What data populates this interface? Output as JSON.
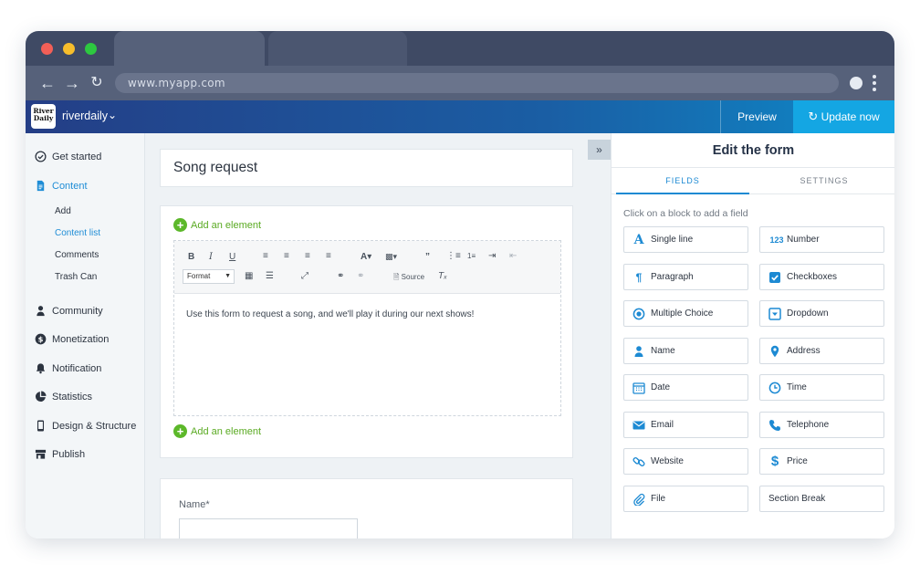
{
  "browser": {
    "url": "www.myapp.com",
    "colors": {
      "close": "#f25f57",
      "minimize": "#f7be2c",
      "maximize": "#2dc840"
    }
  },
  "header": {
    "logo_text": "River Daily",
    "site_name": "riverdaily",
    "preview_label": "Preview",
    "update_label": "Update now"
  },
  "sidebar": {
    "items": [
      {
        "label": "Get started",
        "icon": "check-circle-icon"
      },
      {
        "label": "Content",
        "icon": "document-icon",
        "active": true
      },
      {
        "label": "Community",
        "icon": "user-icon"
      },
      {
        "label": "Monetization",
        "icon": "dollar-icon"
      },
      {
        "label": "Notification",
        "icon": "bell-icon"
      },
      {
        "label": "Statistics",
        "icon": "pie-chart-icon"
      },
      {
        "label": "Design & Structure",
        "icon": "mobile-icon"
      },
      {
        "label": "Publish",
        "icon": "store-icon"
      }
    ],
    "content_sub": [
      "Add",
      "Content list",
      "Comments",
      "Trash Can"
    ]
  },
  "main": {
    "form_title": "Song request",
    "add_element_label": "Add an element",
    "editor": {
      "format_label": "Format",
      "source_label": "Source",
      "body_text": "Use this form to request a song, and we'll play it during our next shows!"
    },
    "name_field_label": "Name*"
  },
  "panel": {
    "title": "Edit the form",
    "tabs": [
      "FIELDS",
      "SETTINGS"
    ],
    "hint": "Click on a block to add a field",
    "fields": [
      {
        "label": "Single line",
        "icon": "text-a-icon"
      },
      {
        "label": "Number",
        "icon": "number-123-icon",
        "icon_text": "123"
      },
      {
        "label": "Paragraph",
        "icon": "paragraph-icon"
      },
      {
        "label": "Checkboxes",
        "icon": "checkbox-icon"
      },
      {
        "label": "Multiple Choice",
        "icon": "radio-icon"
      },
      {
        "label": "Dropdown",
        "icon": "dropdown-icon"
      },
      {
        "label": "Name",
        "icon": "user-icon"
      },
      {
        "label": "Address",
        "icon": "map-pin-icon"
      },
      {
        "label": "Date",
        "icon": "calendar-icon"
      },
      {
        "label": "Time",
        "icon": "clock-icon"
      },
      {
        "label": "Email",
        "icon": "envelope-icon"
      },
      {
        "label": "Telephone",
        "icon": "phone-icon"
      },
      {
        "label": "Website",
        "icon": "link-icon"
      },
      {
        "label": "Price",
        "icon": "dollar-icon"
      },
      {
        "label": "File",
        "icon": "paperclip-icon"
      },
      {
        "label": "Section Break",
        "icon": ""
      }
    ]
  }
}
